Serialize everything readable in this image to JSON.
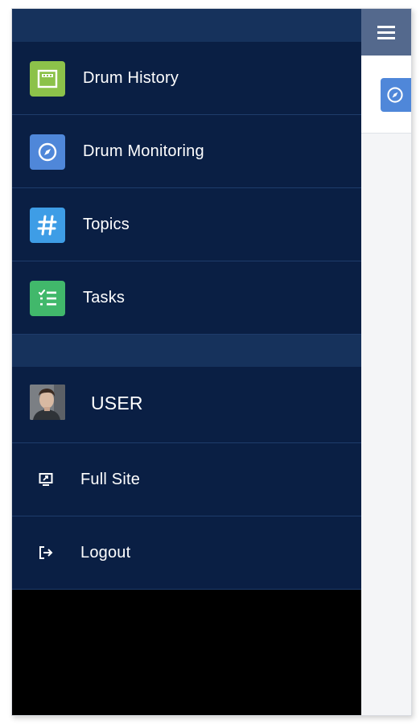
{
  "nav": {
    "items": [
      {
        "label": "Drum History",
        "icon": "drum-history-icon",
        "color": "#8cc24a"
      },
      {
        "label": "Drum Monitoring",
        "icon": "compass-icon",
        "color": "#4f87d9"
      },
      {
        "label": "Topics",
        "icon": "hashtag-icon",
        "color": "#3e9de6"
      },
      {
        "label": "Tasks",
        "icon": "task-list-icon",
        "color": "#41b86b"
      }
    ]
  },
  "user": {
    "label": "USER",
    "icon": "user-avatar"
  },
  "links": {
    "full_site": {
      "label": "Full Site",
      "icon": "full-site-icon"
    },
    "logout": {
      "label": "Logout",
      "icon": "logout-icon"
    }
  },
  "header": {
    "menu_icon": "hamburger-menu-icon"
  },
  "colors": {
    "drawer_bg": "#0a1f44",
    "drawer_header": "#16325c",
    "menu_button": "#54698d",
    "divider": "#1e3c6b"
  }
}
